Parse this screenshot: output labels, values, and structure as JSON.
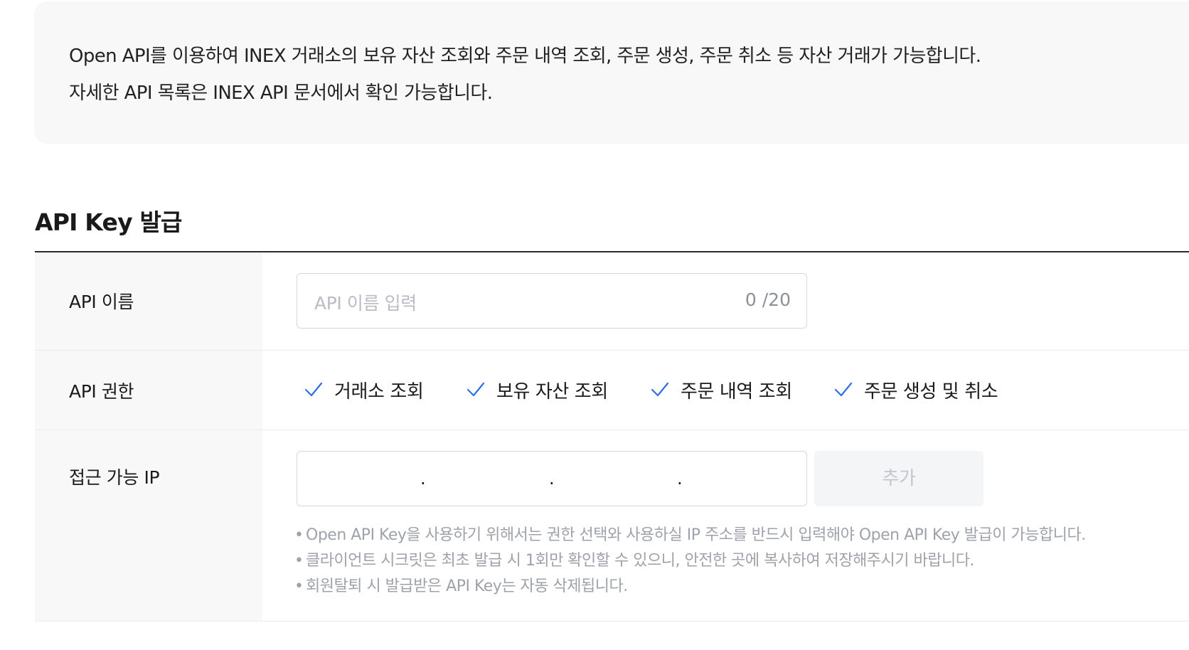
{
  "intro": {
    "line1": "Open API를 이용하여 INEX 거래소의 보유 자산 조회와 주문 내역 조회, 주문 생성, 주문 취소 등 자산 거래가 가능합니다.",
    "line2": "자세한 API 목록은 INEX API 문서에서 확인 가능합니다."
  },
  "section": {
    "title": "API Key 발급"
  },
  "form": {
    "name": {
      "label": "API 이름",
      "placeholder": "API 이름 입력",
      "counter": "0 /20"
    },
    "permissions": {
      "label": "API 권한",
      "items": [
        {
          "label": "거래소 조회",
          "checked": true
        },
        {
          "label": "보유 자산 조회",
          "checked": true
        },
        {
          "label": "주문 내역 조회",
          "checked": true
        },
        {
          "label": "주문 생성 및 취소",
          "checked": true
        }
      ],
      "check_color": "#2f6fe4"
    },
    "ip": {
      "label": "접근 가능 IP",
      "separator": ".",
      "add_label": "추가",
      "notes": [
        "Open API Key을 사용하기 위해서는 권한 선택와 사용하실 IP 주소를 반드시 입력해야 Open API Key 발급이 가능합니다.",
        "클라이언트 시크릿은 최초 발급 시 1회만 확인할 수 있으니, 안전한 곳에 복사하여 저장해주시기 바랍니다.",
        "회원탈퇴 시 발급받은 API Key는 자동 삭제됩니다."
      ]
    }
  }
}
